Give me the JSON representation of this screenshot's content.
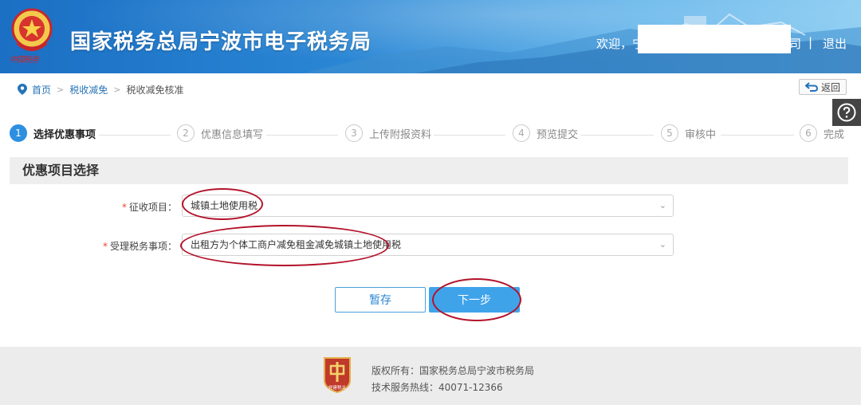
{
  "header": {
    "title": "国家税务总局宁波市电子税务局",
    "emblem_caption": "中国税务",
    "welcome_prefix": "欢迎，宁",
    "welcome_suffix": "司",
    "separator": "|",
    "logout_label": "退出"
  },
  "breadcrumb": {
    "items": [
      "首页",
      "税收减免",
      "税收减免核准"
    ],
    "separator": ">"
  },
  "back_label": "返回",
  "steps": [
    {
      "num": "1",
      "label": "选择优惠事项",
      "active": true
    },
    {
      "num": "2",
      "label": "优惠信息填写",
      "active": false
    },
    {
      "num": "3",
      "label": "上传附报资料",
      "active": false
    },
    {
      "num": "4",
      "label": "预览提交",
      "active": false
    },
    {
      "num": "5",
      "label": "审核中",
      "active": false
    },
    {
      "num": "6",
      "label": "完成",
      "active": false
    }
  ],
  "section": {
    "title": "优惠项目选择"
  },
  "form": {
    "required_mark": "*",
    "levy_item": {
      "label": "征收项目：",
      "value": "城镇土地使用税"
    },
    "tax_matter": {
      "label": "受理税务事项：",
      "value": "出租方为个体工商户减免租金减免城镇土地使用税"
    }
  },
  "buttons": {
    "save": "暂存",
    "next": "下一步"
  },
  "footer": {
    "logo_caption": "党建税关",
    "copyright": "版权所有：国家税务总局宁波市税务局",
    "hotline": "技术服务热线：40071-12366"
  },
  "colors": {
    "accent": "#2d8fe0",
    "annotation": "#b3122a",
    "header": "#2a86d4"
  }
}
